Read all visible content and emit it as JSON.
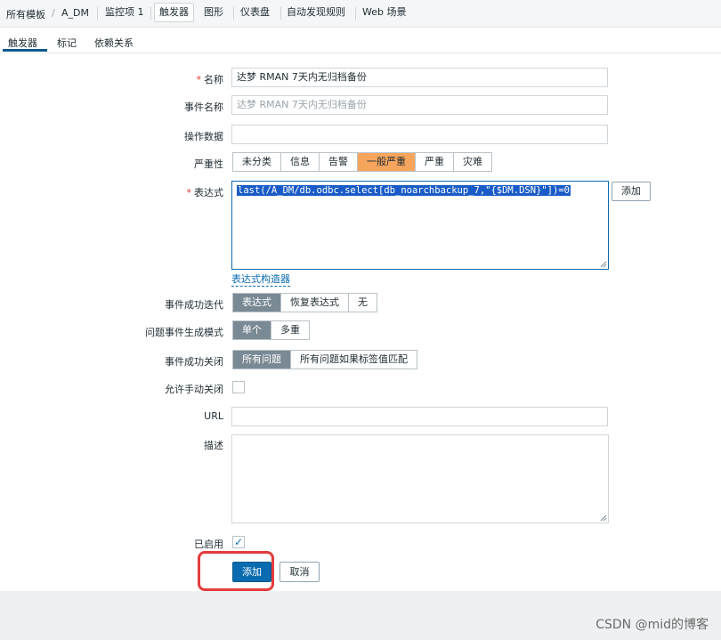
{
  "breadcrumb": {
    "all_templates": "所有模板",
    "template": "A_DM",
    "items_tab": "监控项 1"
  },
  "nav_tabs": [
    "触发器",
    "图形",
    "仪表盘",
    "自动发现规则",
    "Web 场景"
  ],
  "sub_tabs": [
    "触发器",
    "标记",
    "依赖关系"
  ],
  "form": {
    "name_label": "名称",
    "name_value": "达梦 RMAN 7天内无归档备份",
    "event_name_label": "事件名称",
    "event_name_placeholder": "达梦 RMAN 7天内无归档备份",
    "opdata_label": "操作数据",
    "opdata_value": "",
    "severity_label": "严重性",
    "severity_options": [
      "未分类",
      "信息",
      "告警",
      "一般严重",
      "严重",
      "灾难"
    ],
    "severity_selected": "一般严重",
    "expression_label": "表达式",
    "expression_value": "last(/A_DM/db.odbc.select[db_noarchbackup_7,\"{$DM.DSN}\"])=0",
    "expression_add_button": "添加",
    "expression_builder_link": "表达式构造器",
    "ok_event_gen_label": "事件成功迭代",
    "ok_event_gen_options": [
      "表达式",
      "恢复表达式",
      "无"
    ],
    "ok_event_gen_selected": "表达式",
    "problem_mode_label": "问题事件生成模式",
    "problem_mode_options": [
      "单个",
      "多重"
    ],
    "problem_mode_selected": "单个",
    "ok_close_label": "事件成功关闭",
    "ok_close_options": [
      "所有问题",
      "所有问题如果标签值匹配"
    ],
    "ok_close_selected": "所有问题",
    "manual_close_label": "允许手动关闭",
    "manual_close_checked": false,
    "url_label": "URL",
    "url_value": "",
    "description_label": "描述",
    "description_value": "",
    "enabled_label": "已启用",
    "enabled_checked": true,
    "add_button": "添加",
    "cancel_button": "取消"
  },
  "watermark": "CSDN @mid的博客",
  "colors": {
    "accent": "#0a6bb0",
    "severity_selected": "#f6a55c",
    "segment_selected": "#7a8a95",
    "highlight_box": "#e53c3c"
  }
}
